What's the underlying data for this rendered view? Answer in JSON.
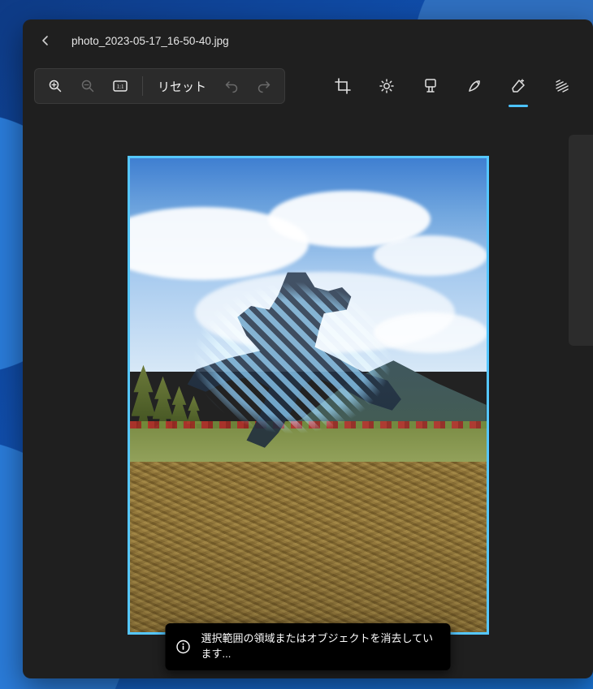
{
  "titlebar": {
    "filename": "photo_2023-05-17_16-50-40.jpg"
  },
  "left_tools": {
    "reset_label": "リセット"
  },
  "toast": {
    "message": "選択範囲の領域またはオブジェクトを消去しています..."
  }
}
